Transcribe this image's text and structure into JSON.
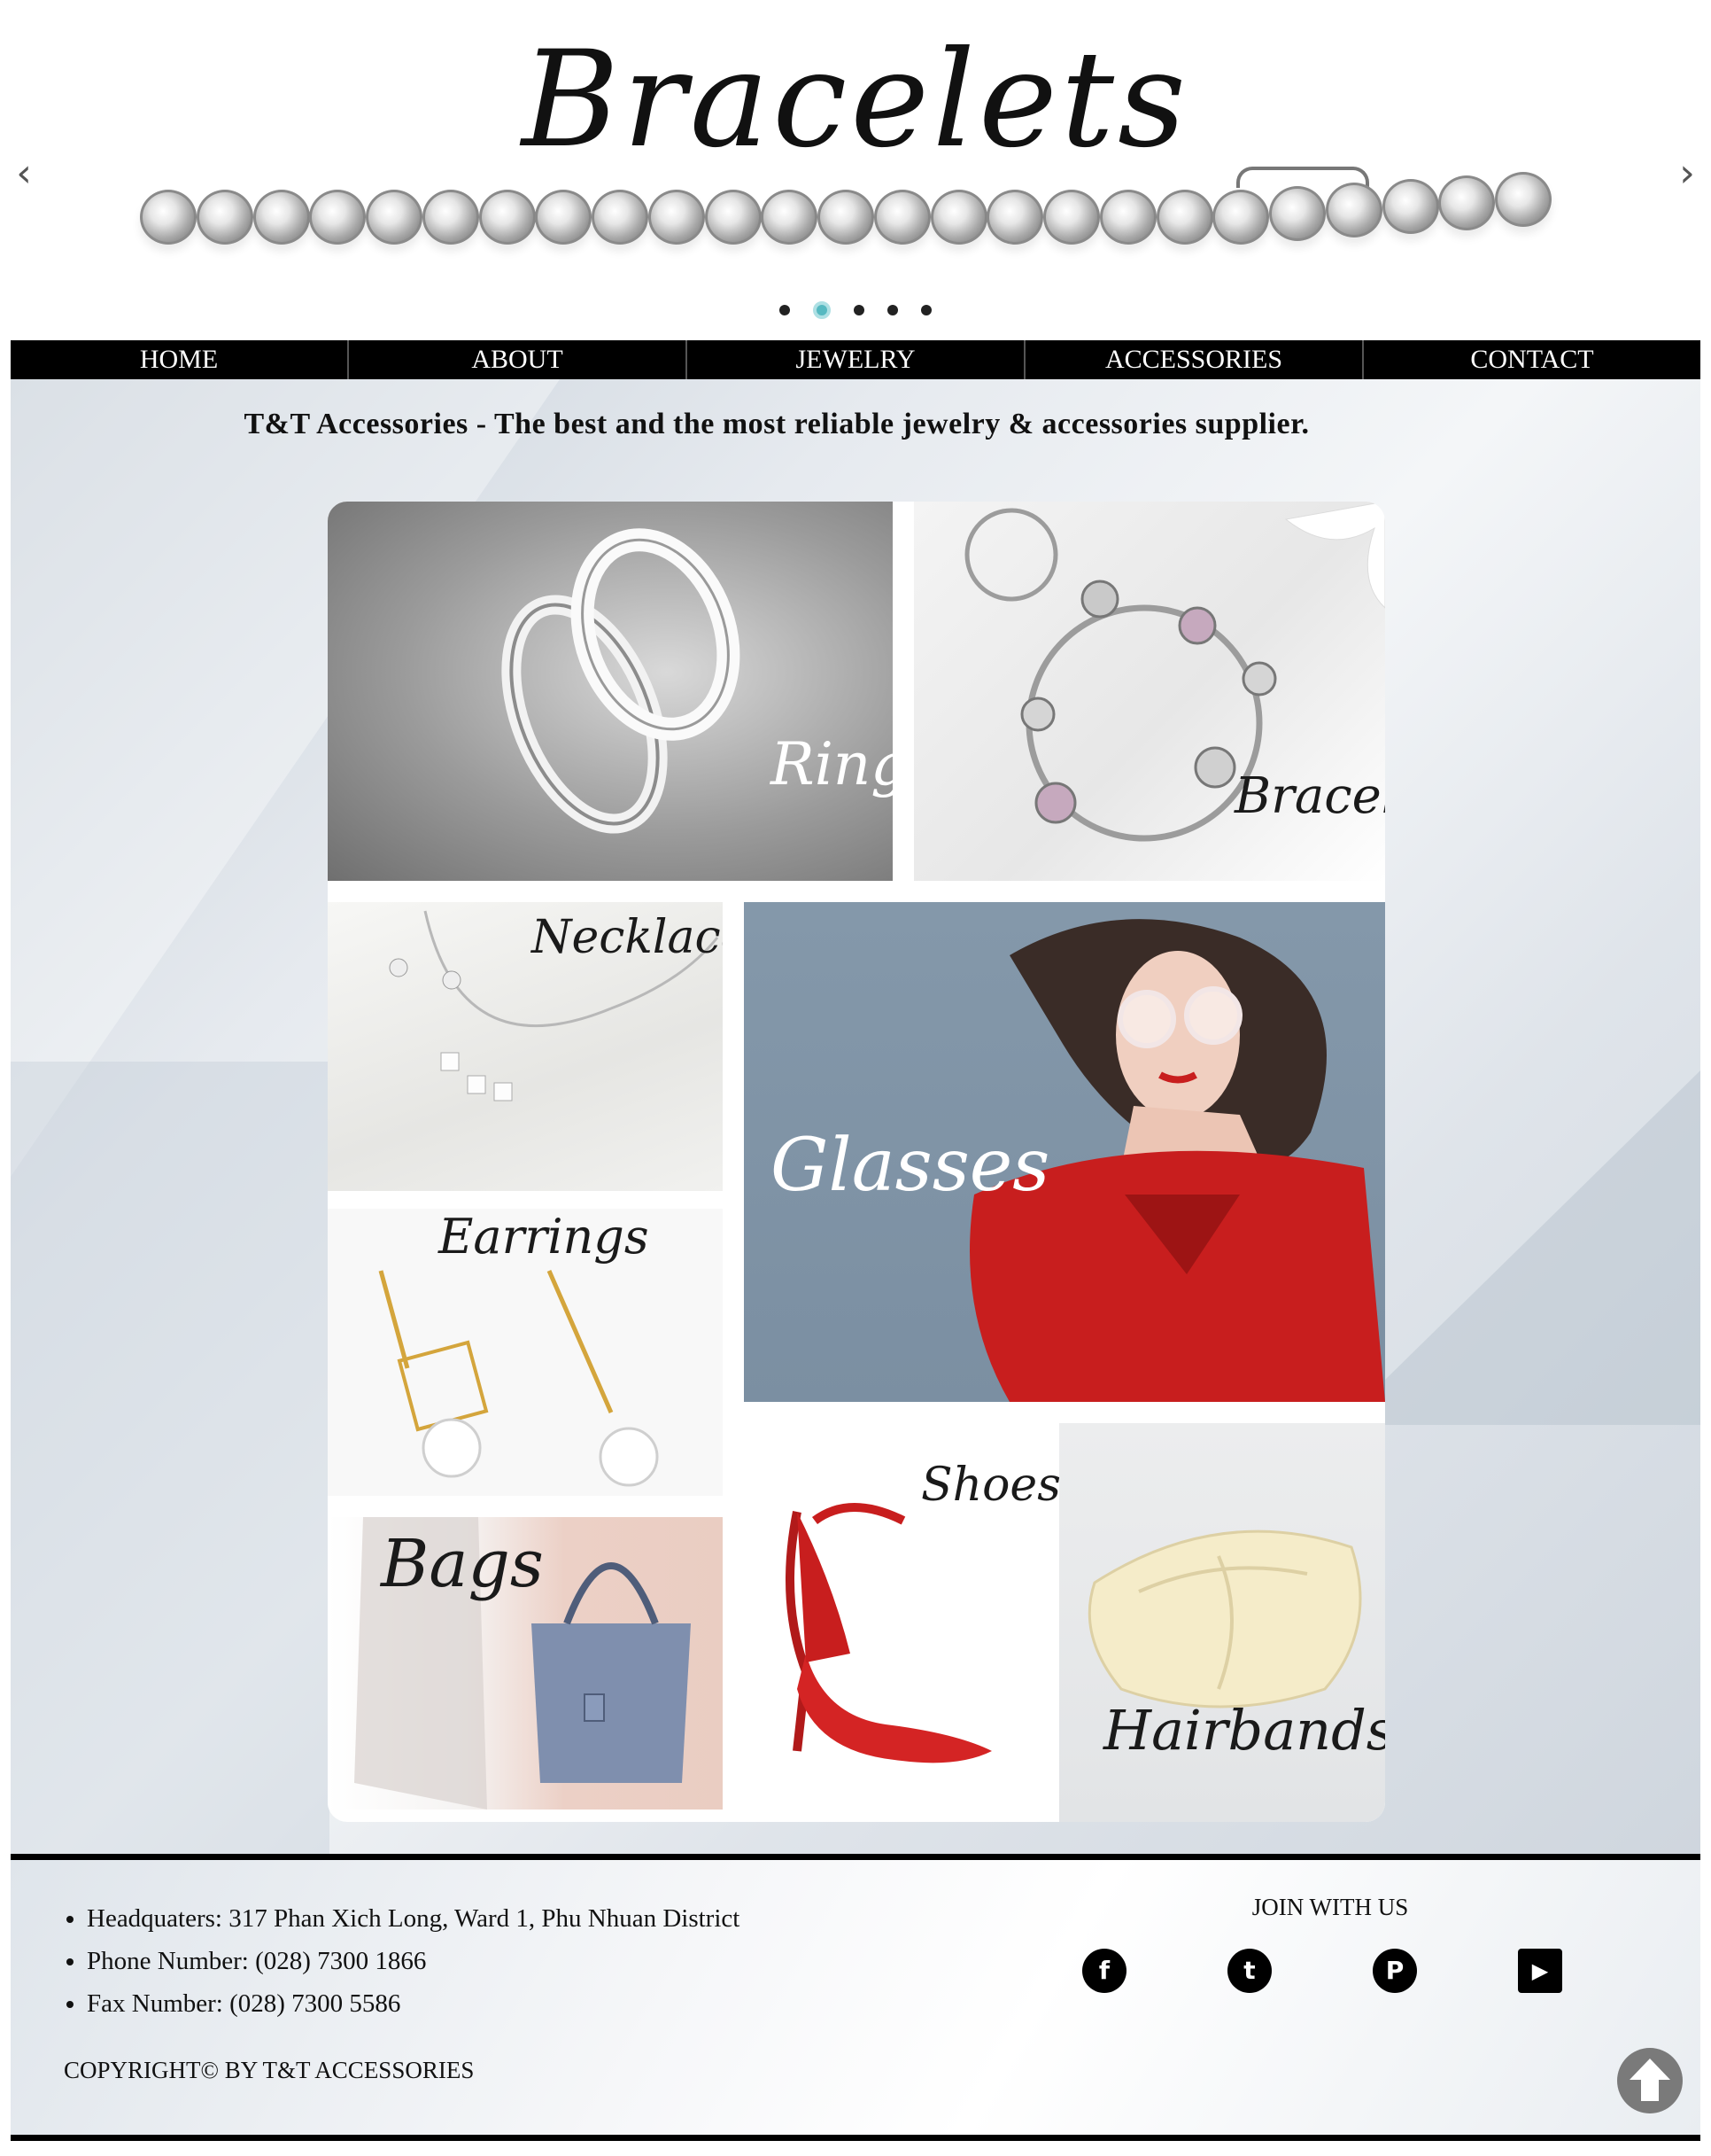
{
  "banner": {
    "title": "Bracelets",
    "prev_icon": "chevron-left-icon",
    "next_icon": "chevron-right-icon",
    "slide_count": 5,
    "active_slide": 2
  },
  "nav": {
    "items": [
      {
        "label": "HOME"
      },
      {
        "label": "ABOUT"
      },
      {
        "label": "JEWELRY"
      },
      {
        "label": "ACCESSORIES"
      },
      {
        "label": "CONTACT"
      }
    ]
  },
  "main": {
    "tagline": "T&T Accessories - The best and the most reliable jewelry & accessories supplier.",
    "gallery": {
      "rings": "Rings",
      "bracelets": "Bracelets",
      "necklaces": "Necklaces",
      "glasses": "Glasses",
      "earrings": "Earrings",
      "bags": "Bags",
      "shoes": "Shoes",
      "hairbands": "Hairbands"
    }
  },
  "footer": {
    "contacts": [
      "Headquaters: 317 Phan Xich Long, Ward 1, Phu Nhuan District",
      "Phone Number: (028) 7300 1866",
      "Fax Number: (028) 7300 5586"
    ],
    "join_title": "JOIN WITH US",
    "social": [
      {
        "icon": "facebook-icon",
        "glyph": "f"
      },
      {
        "icon": "twitter-icon",
        "glyph": "t"
      },
      {
        "icon": "pinterest-icon",
        "glyph": "P"
      },
      {
        "icon": "youtube-icon",
        "glyph": "▶"
      }
    ],
    "copyright": "COPYRIGHT© BY T&T ACCESSORIES",
    "to_top_icon": "arrow-up-icon"
  },
  "colors": {
    "nav_background": "#000000",
    "active_dot": "#56b9c1",
    "glasses_tile_background": "#7f93a6",
    "coat_red": "#c81e1e"
  }
}
